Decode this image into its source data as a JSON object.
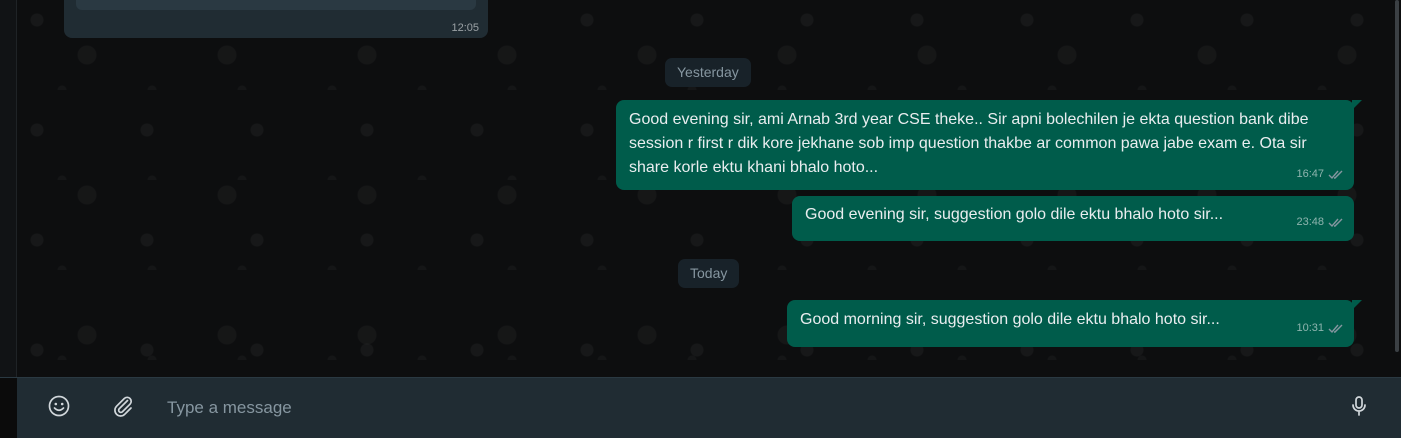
{
  "messages": {
    "prev_incoming": {
      "time": "12:05"
    },
    "separators": {
      "yesterday": "Yesterday",
      "today": "Today"
    },
    "outgoing": [
      {
        "text": "Good evening sir, ami Arnab 3rd year CSE theke.. Sir apni bolechilen je ekta question bank dibe session r first r dik kore jekhane sob imp question thakbe ar common pawa jabe exam e. Ota sir share korle ektu khani bhalo hoto...",
        "time": "16:47",
        "status": "read"
      },
      {
        "text": "Good evening sir, suggestion golo dile ektu bhalo hoto sir...",
        "time": "23:48",
        "status": "read"
      },
      {
        "text": "Good morning sir, suggestion golo dile ektu bhalo hoto sir...",
        "time": "10:31",
        "status": "read"
      }
    ]
  },
  "composer": {
    "placeholder": "Type a message",
    "icons": {
      "emoji": "emoji-icon",
      "attach": "paperclip-icon",
      "mic": "microphone-icon"
    }
  },
  "colors": {
    "outgoing_bubble": "#005c4b",
    "incoming_bubble": "#202c33",
    "composer_bg": "#202c33",
    "chip_bg": "#182229"
  }
}
